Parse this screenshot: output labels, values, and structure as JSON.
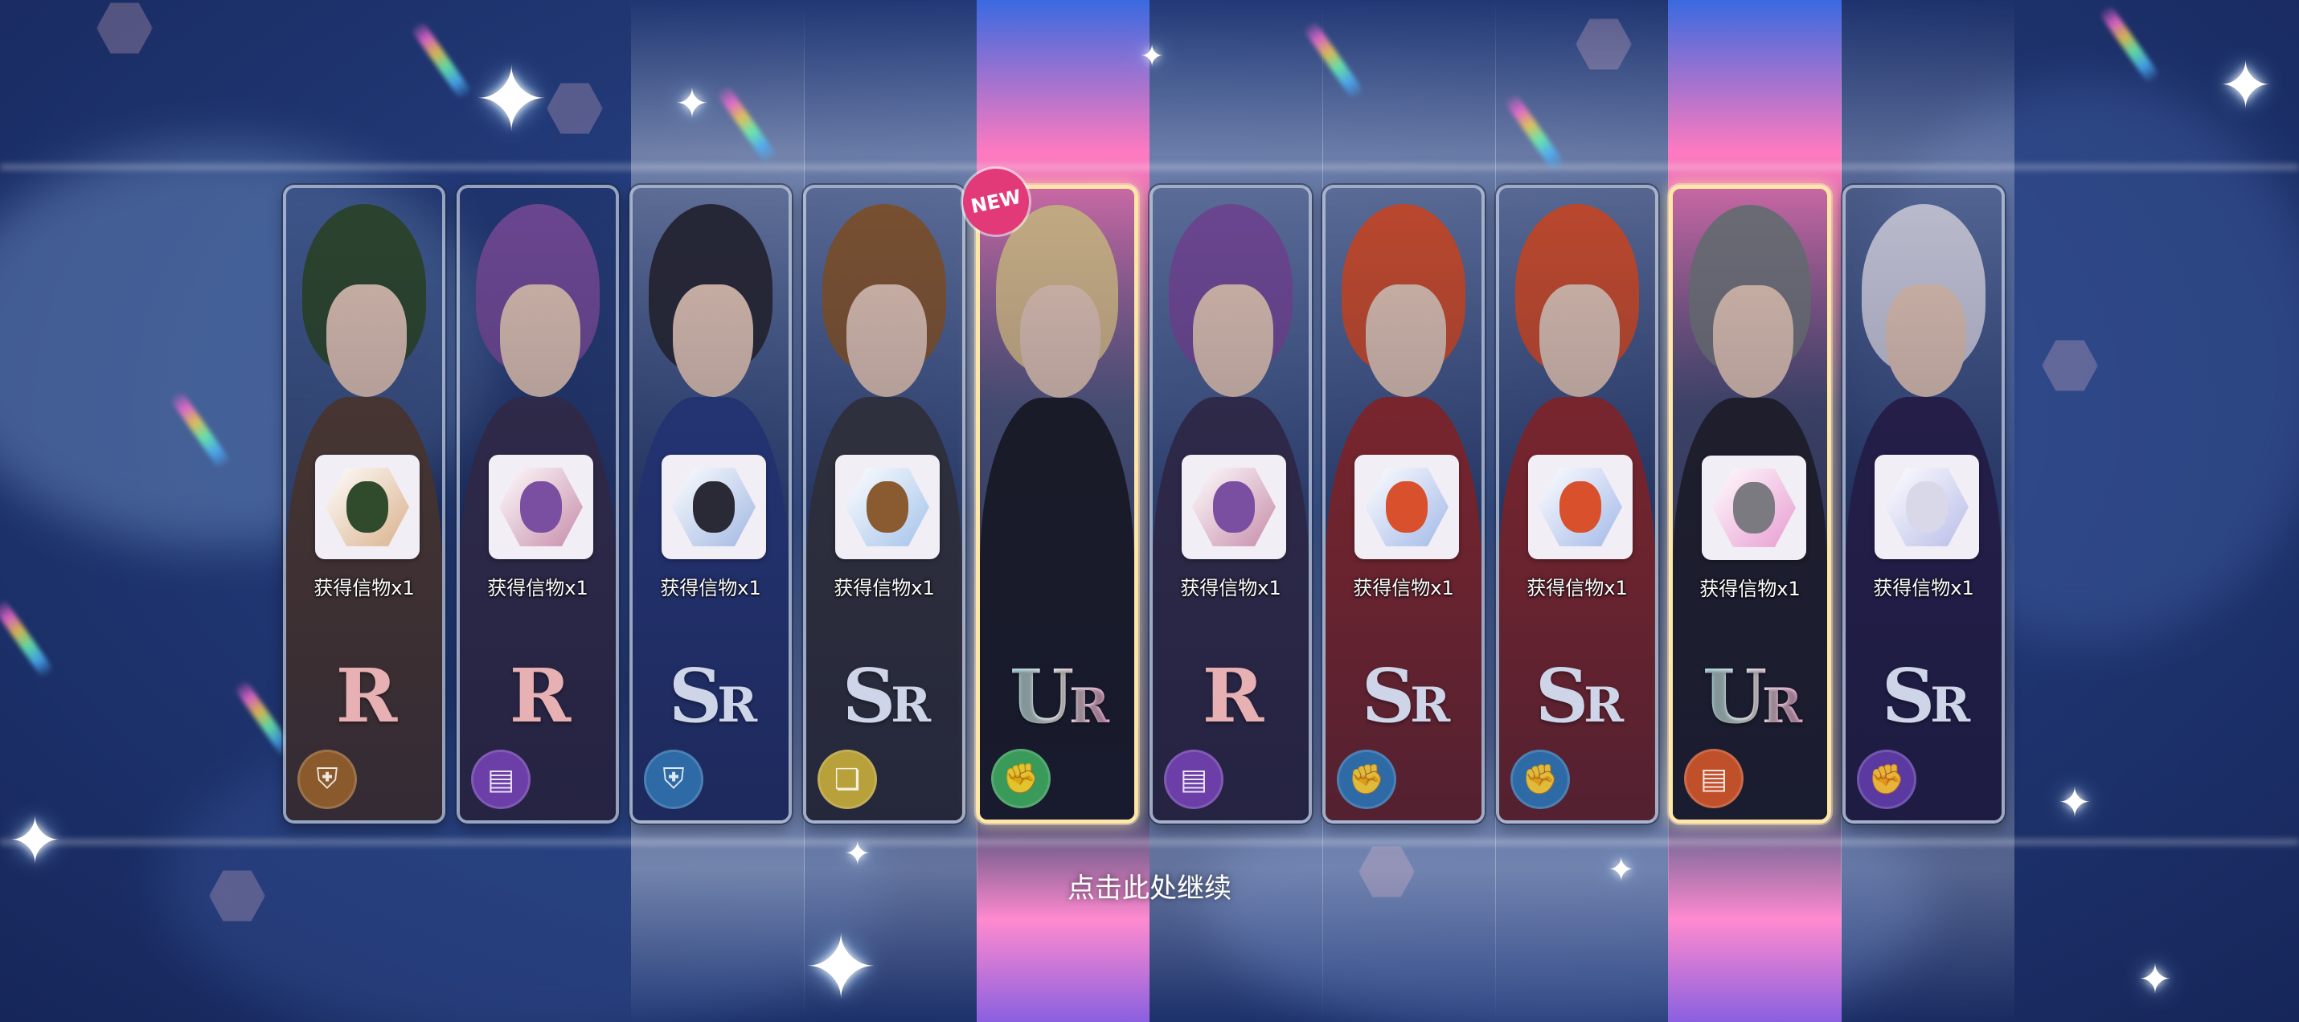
{
  "cards": [
    {
      "rarity": "R",
      "rarity_sub": "",
      "is_new": false,
      "reward": "获得信物x1",
      "attribute_icon": "shield-icon",
      "attribute_color": "#8a5a2c",
      "hair": "#2f4b2c",
      "outfit": "#5a4030",
      "gem": "#d9b08a"
    },
    {
      "rarity": "R",
      "rarity_sub": "",
      "is_new": false,
      "reward": "获得信物x1",
      "attribute_icon": "book-icon",
      "attribute_color": "#6b3ea8",
      "hair": "#7a4ea0",
      "outfit": "#3a3050",
      "gem": "#c68aa8"
    },
    {
      "rarity": "S",
      "rarity_sub": "R",
      "is_new": false,
      "reward": "获得信物x1",
      "attribute_icon": "shield-icon",
      "attribute_color": "#2d6aa6",
      "hair": "#2a2a36",
      "outfit": "#2a3e8a",
      "gem": "#9fb6e2"
    },
    {
      "rarity": "S",
      "rarity_sub": "R",
      "is_new": false,
      "reward": "获得信物x1",
      "attribute_icon": "cards-icon",
      "attribute_color": "#b8a03a",
      "hair": "#8a5a30",
      "outfit": "#3a3a40",
      "gem": "#a2c2ea"
    },
    {
      "rarity": "U",
      "rarity_sub": "R",
      "is_new": true,
      "reward": "",
      "attribute_icon": "fist-icon",
      "attribute_color": "#3a9a5a",
      "hair": "#e2c490",
      "outfit": "#1c1c22",
      "gem": ""
    },
    {
      "rarity": "R",
      "rarity_sub": "",
      "is_new": false,
      "reward": "获得信物x1",
      "attribute_icon": "book-icon",
      "attribute_color": "#6b3ea8",
      "hair": "#7a4ea0",
      "outfit": "#3a3050",
      "gem": "#c68aa8"
    },
    {
      "rarity": "S",
      "rarity_sub": "R",
      "is_new": false,
      "reward": "获得信物x1",
      "attribute_icon": "fist-icon",
      "attribute_color": "#2d6aa6",
      "hair": "#d8502c",
      "outfit": "#a02a2a",
      "gem": "#a2b8e8"
    },
    {
      "rarity": "S",
      "rarity_sub": "R",
      "is_new": false,
      "reward": "获得信物x1",
      "attribute_icon": "fist-icon",
      "attribute_color": "#2d6aa6",
      "hair": "#d8502c",
      "outfit": "#a02a2a",
      "gem": "#a2b8e8"
    },
    {
      "rarity": "U",
      "rarity_sub": "R",
      "is_new": false,
      "reward": "获得信物x1",
      "attribute_icon": "book-icon",
      "attribute_color": "#c0502a",
      "hair": "#7a7a80",
      "outfit": "#222028",
      "gem": "#e89ad0"
    },
    {
      "rarity": "S",
      "rarity_sub": "R",
      "is_new": false,
      "reward": "获得信物x1",
      "attribute_icon": "fist-icon",
      "attribute_color": "#5a3aa0",
      "hair": "#d8d8e8",
      "outfit": "#2a2050",
      "gem": "#b8bce8"
    }
  ],
  "new_badge": "NEW",
  "continue_text": "点击此处继续"
}
